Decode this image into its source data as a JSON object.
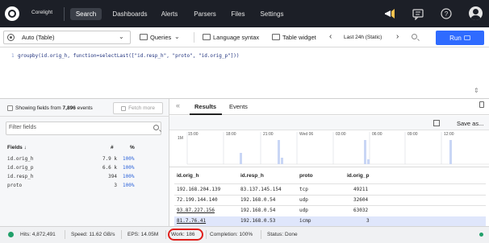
{
  "nav": {
    "brand": "Corelight",
    "tabs": [
      {
        "label": "Search",
        "active": true
      },
      {
        "label": "Dashboards"
      },
      {
        "label": "Alerts"
      },
      {
        "label": "Parsers"
      },
      {
        "label": "Files"
      },
      {
        "label": "Settings"
      }
    ],
    "icons": [
      "megaphone-icon",
      "chat-icon",
      "help-icon",
      "user-avatar"
    ],
    "accent": "#f2c14e"
  },
  "toolbar": {
    "repo": "Auto (Table)",
    "queries": "Queries",
    "language_syntax": "Language syntax",
    "table_widget": "Table widget",
    "time_range": "Last 24h (Static)",
    "run_label": "Run",
    "run_color": "#2f6bff"
  },
  "editor": {
    "line_number": "1",
    "code": "groupby(id.orig_h, function=selectLast([\"id.resp_h\", \"proto\", \"id.orig_p\"]))"
  },
  "fields_panel": {
    "showing_prefix": "Showing fields from",
    "showing_count": "7,896",
    "showing_suffix": "events",
    "fetch_more": "Fetch more",
    "filter_placeholder": "Filter fields",
    "headers": {
      "fields": "Fields ↓",
      "count": "#",
      "percent": "%"
    },
    "rows": [
      {
        "name": "id.orig_h",
        "count": "7.9 k",
        "percent": "100%"
      },
      {
        "name": "id.orig_p",
        "count": "6.6 k",
        "percent": "100%"
      },
      {
        "name": "id.resp_h",
        "count": "394",
        "percent": "100%"
      },
      {
        "name": "proto",
        "count": "3",
        "percent": "100%"
      }
    ]
  },
  "results": {
    "tabs": [
      "Results",
      "Events"
    ],
    "save_as": "Save as...",
    "chart": {
      "scale_label": "1M",
      "time_labels": [
        "15:00",
        "18:00",
        "21:00",
        "Wed 06",
        "03:00",
        "06:00",
        "09:00",
        "12:00"
      ]
    },
    "table": {
      "columns": [
        "id.orig_h",
        "id.resp_h",
        "proto",
        "id.orig_p"
      ],
      "rows": [
        [
          "192.168.204.139",
          "83.137.145.154",
          "tcp",
          "49211"
        ],
        [
          "72.199.144.140",
          "192.168.0.54",
          "udp",
          "32604"
        ],
        [
          "93.87.227.156",
          "192.168.0.54",
          "udp",
          "63032"
        ],
        [
          "81.7.76.41",
          "192.168.0.53",
          "icmp",
          "3"
        ]
      ]
    }
  },
  "status": {
    "hits": "Hits: 4,872,491",
    "speed": "Speed: 11.62 GB/s",
    "eps": "EPS: 14.05M",
    "work": "Work: 186",
    "completion": "Completion: 100%",
    "state": "Status: Done",
    "highlight_color": "#e0201b"
  }
}
